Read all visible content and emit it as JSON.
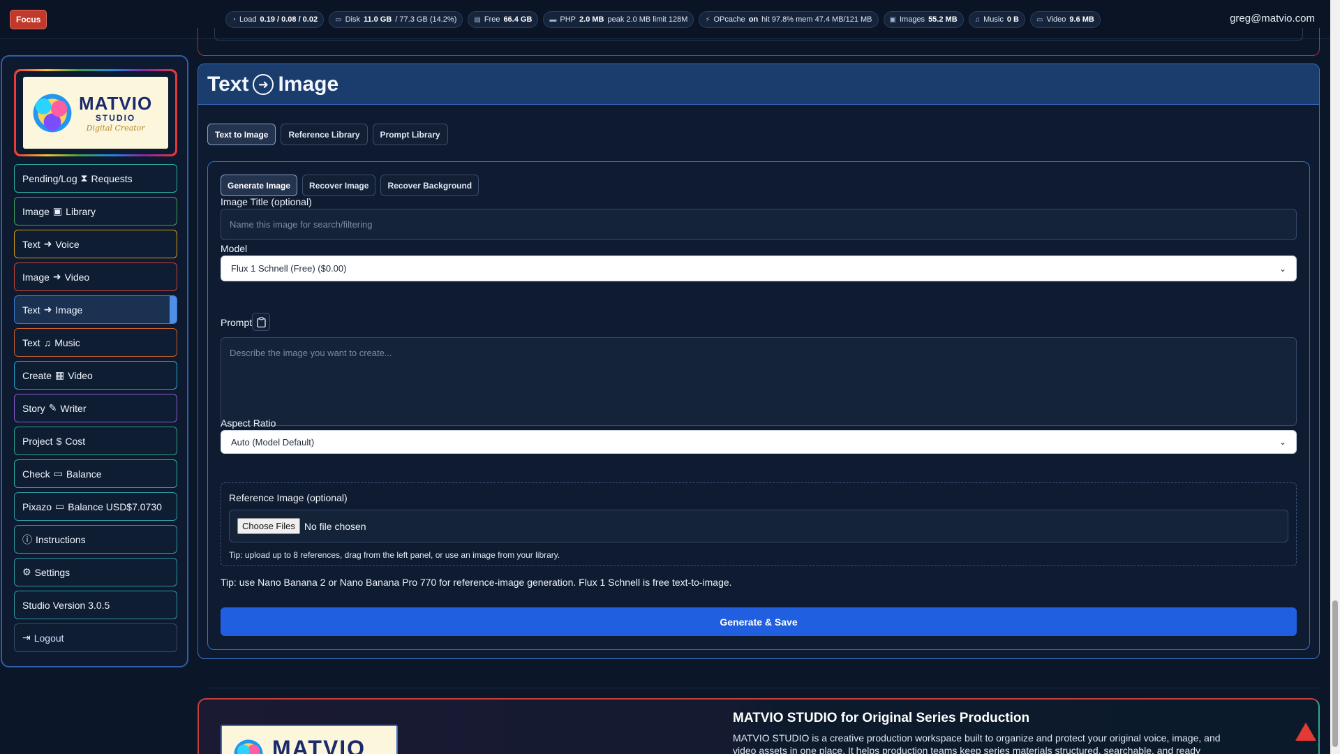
{
  "topbar": {
    "focus_label": "Focus",
    "stats": [
      {
        "icon": "gauge-icon",
        "glyph": "◔",
        "label": "Load",
        "value": "0.19 / 0.08 / 0.02",
        "extra": ""
      },
      {
        "icon": "disk-icon",
        "glyph": "▭",
        "label": "Disk",
        "value": "11.0 GB",
        "extra": "/ 77.3 GB (14.2%)"
      },
      {
        "icon": "database-icon",
        "glyph": "▤",
        "label": "Free",
        "value": "66.4 GB",
        "extra": ""
      },
      {
        "icon": "memory-icon",
        "glyph": "▬",
        "label": "PHP",
        "value": "2.0 MB",
        "extra": "peak 2.0 MB limit 128M"
      },
      {
        "icon": "lightning-icon",
        "glyph": "⚡",
        "label": "OPcache",
        "value": "on",
        "extra": "hit 97.8% mem 47.4 MB/121 MB"
      },
      {
        "icon": "image-icon",
        "glyph": "▣",
        "label": "Images",
        "value": "55.2 MB",
        "extra": ""
      },
      {
        "icon": "music-icon",
        "glyph": "♫",
        "label": "Music",
        "value": "0 B",
        "extra": ""
      },
      {
        "icon": "video-icon",
        "glyph": "▭",
        "label": "Video",
        "value": "9.6 MB",
        "extra": ""
      }
    ],
    "user_email": "greg@matvio.com"
  },
  "sidebar": {
    "logo": {
      "title": "MATVIO",
      "subtitle": "STUDIO",
      "script": "Digital Creator"
    },
    "items": [
      {
        "name": "pending-log-requests",
        "icon": "hourglass-icon",
        "before": "Pending/Log",
        "glyph": "⧗",
        "after": "Requests",
        "border": "b-teal"
      },
      {
        "name": "image-library",
        "icon": "images-icon",
        "before": "Image",
        "glyph": "▣",
        "after": "Library",
        "border": "b-green"
      },
      {
        "name": "text-voice",
        "icon": "arrow-circle-icon",
        "before": "Text",
        "glyph": "➜",
        "after": "Voice",
        "border": "b-yellow"
      },
      {
        "name": "image-video",
        "icon": "arrow-circle-icon",
        "before": "Image",
        "glyph": "➜",
        "after": "Video",
        "border": "b-red"
      },
      {
        "name": "text-image",
        "icon": "arrow-circle-icon",
        "before": "Text",
        "glyph": "➜",
        "after": "Image",
        "border": "b-blue"
      },
      {
        "name": "text-music",
        "icon": "music-list-icon",
        "before": "Text",
        "glyph": "♫",
        "after": "Music",
        "border": "b-orange"
      },
      {
        "name": "create-video",
        "icon": "film-icon",
        "before": "Create",
        "glyph": "▦",
        "after": "Video",
        "border": "b-cyan"
      },
      {
        "name": "story-writer",
        "icon": "edit-icon",
        "before": "Story",
        "glyph": "✎",
        "after": "Writer",
        "border": "b-purple"
      },
      {
        "name": "project-cost",
        "icon": "dollar-icon",
        "before": "Project",
        "glyph": "$",
        "after": "Cost",
        "border": "b-mint"
      },
      {
        "name": "check-balance",
        "icon": "wallet-icon",
        "before": "Check",
        "glyph": "▭",
        "after": "Balance",
        "border": "b-teal"
      },
      {
        "name": "pixazo-balance",
        "icon": "wallet-icon",
        "before": "Pixazo",
        "glyph": "▭",
        "after": "Balance USD$7.0730",
        "border": "b-sea"
      },
      {
        "name": "instructions",
        "icon": "info-icon",
        "before": "",
        "glyph": "ⓘ",
        "after": "Instructions",
        "border": "b-sea"
      },
      {
        "name": "settings",
        "icon": "gear-icon",
        "before": "",
        "glyph": "⚙",
        "after": "Settings",
        "border": "b-sea"
      },
      {
        "name": "studio-version",
        "icon": "",
        "before": "Studio Version 3.0.5",
        "glyph": "",
        "after": "",
        "border": "b-sea"
      },
      {
        "name": "logout",
        "icon": "logout-icon",
        "before": "",
        "glyph": "⇥",
        "after": "Logout",
        "border": "b-gray"
      }
    ],
    "active_index": 4
  },
  "panel": {
    "title_left": "Text",
    "title_right": "Image",
    "tabs": [
      "Text to Image",
      "Reference Library",
      "Prompt Library"
    ],
    "active_tab": 0,
    "subtabs": [
      "Generate Image",
      "Recover Image",
      "Recover Background"
    ],
    "active_subtab": 0,
    "image_title_label": "Image Title (optional)",
    "image_title_placeholder": "Name this image for search/filtering",
    "image_title_value": "",
    "model_label": "Model",
    "model_value": "Flux 1 Schnell (Free) ($0.00)",
    "prompt_label": "Prompt",
    "prompt_placeholder": "Describe the image you want to create...",
    "aspect_label": "Aspect Ratio",
    "aspect_value": "Auto (Model Default)",
    "ref_label": "Reference Image (optional)",
    "file_button": "Choose Files",
    "file_status": "No file chosen",
    "ref_tip": "Tip: upload up to 8 references, drag from the left panel, or use an image from your library.",
    "main_tip": "Tip: use Nano Banana 2 or Nano Banana Pro 770 for reference-image generation. Flux 1 Schnell is free text-to-image.",
    "generate_label": "Generate & Save"
  },
  "promo": {
    "logo_title": "MATVIO",
    "title": "MATVIO STUDIO for Original Series Production",
    "description": "MATVIO STUDIO is a creative production workspace built to organize and protect your original voice, image, and video assets in one place. It helps production teams keep series materials structured, searchable, and ready"
  }
}
